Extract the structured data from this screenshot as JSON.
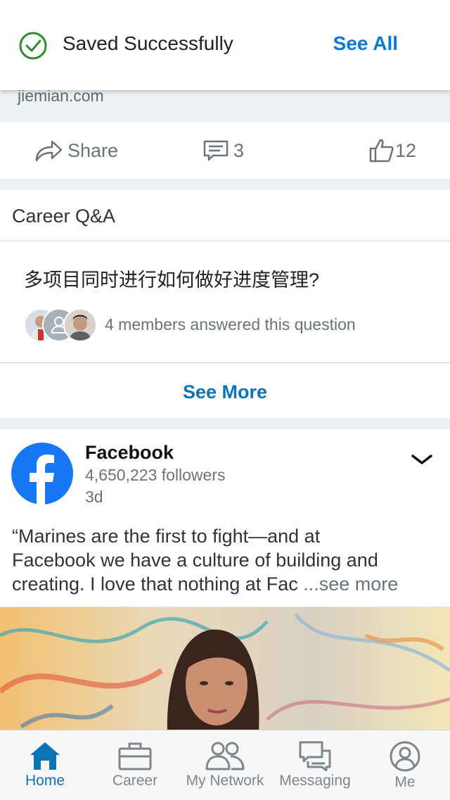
{
  "toast": {
    "message": "Saved Successfully",
    "action": "See All",
    "colors": {
      "check": "#2e8b2e",
      "action": "#0a78d6"
    }
  },
  "source": {
    "domain": "jiemian.com"
  },
  "actions": {
    "share_label": "Share",
    "comments_count": "3",
    "likes_count": "12"
  },
  "career_qa": {
    "heading": "Career Q&A",
    "question": "多项目同时进行如何做好进度管理?",
    "answered_text": "4 members answered this question",
    "see_more": "See More"
  },
  "post": {
    "company": "Facebook",
    "followers": "4,650,223 followers",
    "age": "3d",
    "body_line1": "“Marines are the first to fight—and at",
    "body_line2": "Facebook we have a culture of building and",
    "body_line3": "creating. I love that nothing at Fac ",
    "see_more": "...see more",
    "brand_color": "#1877f2"
  },
  "tabbar": {
    "items": [
      {
        "label": "Home",
        "icon": "home-icon",
        "active": true
      },
      {
        "label": "Career",
        "icon": "briefcase-icon",
        "active": false
      },
      {
        "label": "My Network",
        "icon": "network-icon",
        "active": false
      },
      {
        "label": "Messaging",
        "icon": "messaging-icon",
        "active": false
      },
      {
        "label": "Me",
        "icon": "profile-icon",
        "active": false
      }
    ],
    "colors": {
      "active": "#0a74b6",
      "inactive": "#7d868c"
    }
  }
}
